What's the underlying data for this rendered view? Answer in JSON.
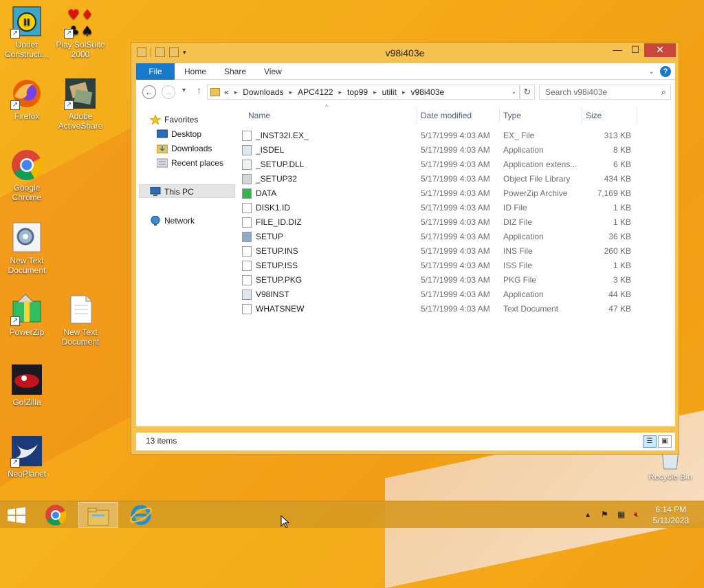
{
  "desktop": {
    "icons": [
      {
        "label": "Under Constructi...",
        "icon": "under-construction-icon"
      },
      {
        "label": "Play SolSuite 2000",
        "icon": "solsuite-icon"
      },
      {
        "label": "Firefox",
        "icon": "firefox-icon"
      },
      {
        "label": "Adobe ActiveShare",
        "icon": "activeshare-icon"
      },
      {
        "label": "Google Chrome",
        "icon": "chrome-icon"
      },
      {
        "label": "New Text Document",
        "icon": "text-document-icon"
      },
      {
        "label": "PowerZip",
        "icon": "powerzip-icon"
      },
      {
        "label": "New Text Document",
        "icon": "text-document-icon"
      },
      {
        "label": "Go!Zilla",
        "icon": "gozilla-icon"
      },
      {
        "label": "NeoPlanet",
        "icon": "neoplanet-icon"
      },
      {
        "label": "Recycle Bin",
        "icon": "recycle-bin-icon"
      }
    ]
  },
  "window": {
    "title": "v98i403e",
    "controls": {
      "minimize": "—",
      "maximize": "☐",
      "close": "✕"
    }
  },
  "ribbon": {
    "tabs": [
      "File",
      "Home",
      "Share",
      "View"
    ],
    "help": "?"
  },
  "navbar": {
    "breadcrumb_lead": "«",
    "breadcrumbs": [
      "Downloads",
      "APC4122",
      "top99",
      "utilit",
      "v98i403e"
    ],
    "search_placeholder": "Search v98i403e"
  },
  "navpane": {
    "favorites": "Favorites",
    "desktop": "Desktop",
    "downloads": "Downloads",
    "recent": "Recent places",
    "thispc": "This PC",
    "network": "Network"
  },
  "columns": {
    "name": "Name",
    "date": "Date modified",
    "type": "Type",
    "size": "Size"
  },
  "files": [
    {
      "name": "_INST32I.EX_",
      "date": "5/17/1999 4:03 AM",
      "type": "EX_ File",
      "size": "313 KB",
      "icon": "generic-file-icon"
    },
    {
      "name": "_ISDEL",
      "date": "5/17/1999 4:03 AM",
      "type": "Application",
      "size": "8 KB",
      "icon": "application-icon"
    },
    {
      "name": "_SETUP.DLL",
      "date": "5/17/1999 4:03 AM",
      "type": "Application extens...",
      "size": "6 KB",
      "icon": "dll-icon"
    },
    {
      "name": "_SETUP32",
      "date": "5/17/1999 4:03 AM",
      "type": "Object File Library",
      "size": "434 KB",
      "icon": "library-icon"
    },
    {
      "name": "DATA",
      "date": "5/17/1999 4:03 AM",
      "type": "PowerZip Archive",
      "size": "7,169 KB",
      "icon": "archive-icon"
    },
    {
      "name": "DISK1.ID",
      "date": "5/17/1999 4:03 AM",
      "type": "ID File",
      "size": "1 KB",
      "icon": "generic-file-icon"
    },
    {
      "name": "FILE_ID.DIZ",
      "date": "5/17/1999 4:03 AM",
      "type": "DIZ File",
      "size": "1 KB",
      "icon": "generic-file-icon"
    },
    {
      "name": "SETUP",
      "date": "5/17/1999 4:03 AM",
      "type": "Application",
      "size": "36 KB",
      "icon": "setup-icon"
    },
    {
      "name": "SETUP.INS",
      "date": "5/17/1999 4:03 AM",
      "type": "INS File",
      "size": "260 KB",
      "icon": "generic-file-icon"
    },
    {
      "name": "SETUP.ISS",
      "date": "5/17/1999 4:03 AM",
      "type": "ISS File",
      "size": "1 KB",
      "icon": "generic-file-icon"
    },
    {
      "name": "SETUP.PKG",
      "date": "5/17/1999 4:03 AM",
      "type": "PKG File",
      "size": "3 KB",
      "icon": "generic-file-icon"
    },
    {
      "name": "V98INST",
      "date": "5/17/1999 4:03 AM",
      "type": "Application",
      "size": "44 KB",
      "icon": "application-icon"
    },
    {
      "name": "WHATSNEW",
      "date": "5/17/1999 4:03 AM",
      "type": "Text Document",
      "size": "47 KB",
      "icon": "text-file-icon"
    }
  ],
  "status": {
    "count": "13 items"
  },
  "taskbar": {
    "time": "6:14 PM",
    "date": "5/11/2023"
  },
  "colors": {
    "accent": "#1979ca",
    "frame": "#f5c250",
    "close": "#c9483c"
  }
}
